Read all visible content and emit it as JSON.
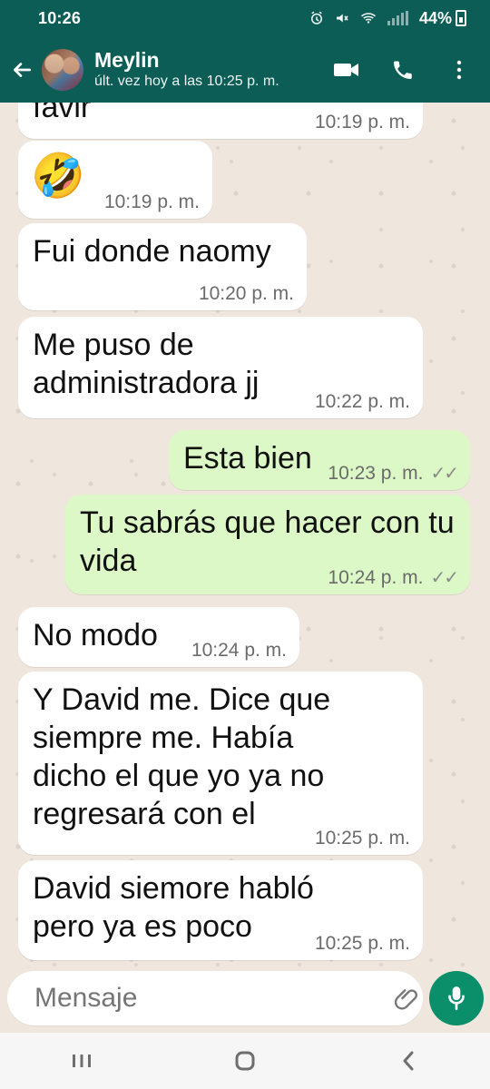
{
  "status_bar": {
    "time": "10:26",
    "battery": "44%"
  },
  "chat_header": {
    "contact_name": "Meylin",
    "last_seen": "últ. vez hoy a las 10:25 p. m.",
    "icons": [
      "back-arrow-icon",
      "avatar",
      "video-call-icon",
      "phone-icon",
      "more-vert-icon"
    ]
  },
  "messages": [
    {
      "dir": "in",
      "text": "favir",
      "time": "10:19 p. m."
    },
    {
      "dir": "in",
      "text": "🤣",
      "time": "10:19 p. m."
    },
    {
      "dir": "in",
      "text": "Fui donde naomy",
      "time": "10:20 p. m."
    },
    {
      "dir": "in",
      "text": "Me puso de administradora jj",
      "time": "10:22 p. m."
    },
    {
      "dir": "out",
      "text": "Esta bien",
      "time": "10:23 p. m.",
      "ticks": "✓✓"
    },
    {
      "dir": "out",
      "text": "Tu sabrás que hacer con tu vida",
      "time": "10:24 p. m.",
      "ticks": "✓✓"
    },
    {
      "dir": "in",
      "text": "No modo",
      "time": "10:24 p. m."
    },
    {
      "dir": "in",
      "text": "Y David me. Dice que siempre me. Había dicho el que yo ya no regresará con el",
      "time": "10:25 p. m."
    },
    {
      "dir": "in",
      "text": "David siemore habló pero ya es poco",
      "time": "10:25 p. m."
    }
  ],
  "composer": {
    "placeholder": "Mensaje"
  },
  "colors": {
    "header_bg": "#0b5d55",
    "chat_bg": "#efe7dd",
    "incoming_bubble": "#ffffff",
    "outgoing_bubble": "#dcf8c6",
    "mic_button": "#0a8f6a"
  }
}
